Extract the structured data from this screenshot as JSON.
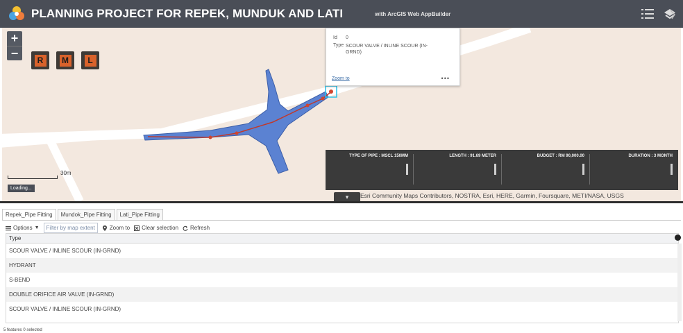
{
  "header": {
    "title": "PLANNING PROJECT FOR REPEK, MUNDUK AND LATI",
    "subtitle": "with ArcGIS Web AppBuilder"
  },
  "map": {
    "zoom_in": "+",
    "zoom_out": "−",
    "letter_buttons": [
      "R",
      "M",
      "L"
    ],
    "scale_label": "30m",
    "loading_text": "Loading...",
    "attribution": "Esri Community Maps Contributors, NOSTRA, Esri, HERE, Garmin, Foursquare, METI/NASA, USGS",
    "popup": {
      "id_label": "Id",
      "id_value": "0",
      "type_label": "Type",
      "type_value": "SCOUR VALVE / INLINE SCOUR (IN-GRND)",
      "zoom_to": "Zoom to",
      "more": "•••"
    },
    "info_panel": [
      {
        "label": "TYPE OF PIPE : MSCL 150MM"
      },
      {
        "label": "LENGTH : 91.69 METER"
      },
      {
        "label": "BUDGET : RM 90,000.00"
      },
      {
        "label": "DURATION : 3 MONTH"
      }
    ],
    "collapse_glyph": "▾",
    "colors": {
      "header_bg": "#4a4e57",
      "map_bg": "#f3e8df",
      "polygon_fill": "#5b82d2",
      "pipeline_color": "#c0392b",
      "button_accent": "#d9622b"
    }
  },
  "attribute_table": {
    "tabs": [
      "Repek_Pipe Fitting",
      "Mundok_Pipe Fitting",
      "Lati_Pipe Fitting"
    ],
    "toolbar": {
      "options": "Options",
      "filter": "Filter by map extent",
      "zoom_to": "Zoom to",
      "clear_selection": "Clear selection",
      "refresh": "Refresh"
    },
    "column_header": "Type",
    "rows": [
      "SCOUR VALVE / INLINE SCOUR (IN-GRND)",
      "HYDRANT",
      "S-BEND",
      "DOUBLE ORIFICE AIR VALVE (IN-GRND)",
      "SCOUR VALVE / INLINE SCOUR (IN-GRND)"
    ],
    "status": "5 features 0 selected"
  }
}
